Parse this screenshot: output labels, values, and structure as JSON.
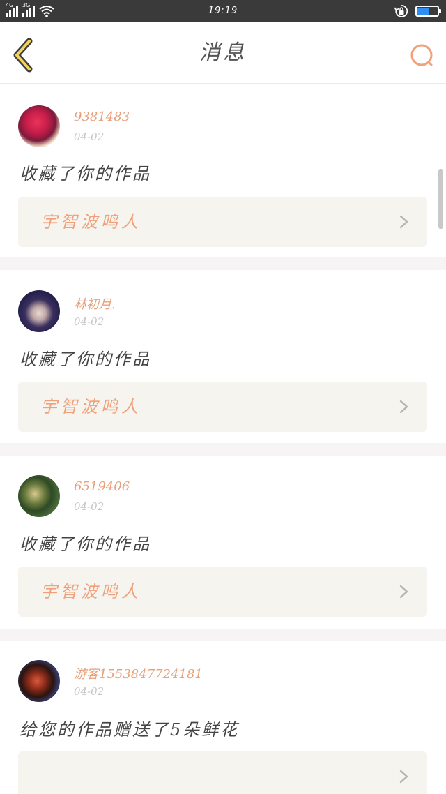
{
  "status_bar": {
    "time": "19:19",
    "network_1": "4G",
    "network_2": "3G",
    "battery_fill_fraction": 0.55,
    "icons": [
      "signal-icon",
      "wifi-icon",
      "rotation-lock-icon",
      "battery-icon"
    ]
  },
  "header": {
    "title": "消息",
    "back_icon": "chevron-left-icon",
    "search_icon": "search-icon",
    "accent_color": "#f0a07a"
  },
  "messages": [
    {
      "username": "9381483",
      "date": "04-02",
      "text": "收藏了你的作品",
      "work_title": "宇智波鸣人",
      "avatar": "red-rose-avatar"
    },
    {
      "username": "林初月.",
      "date": "04-02",
      "text": "收藏了你的作品",
      "work_title": "宇智波鸣人",
      "avatar": "anime-boy-avatar"
    },
    {
      "username": "6519406",
      "date": "04-02",
      "text": "收藏了你的作品",
      "work_title": "宇智波鸣人",
      "avatar": "nature-avatar"
    },
    {
      "username": "游客1553847724181",
      "date": "04-02",
      "text": "给您的作品赠送了5朵鲜花",
      "work_title": "",
      "avatar": "dark-red-avatar"
    }
  ]
}
